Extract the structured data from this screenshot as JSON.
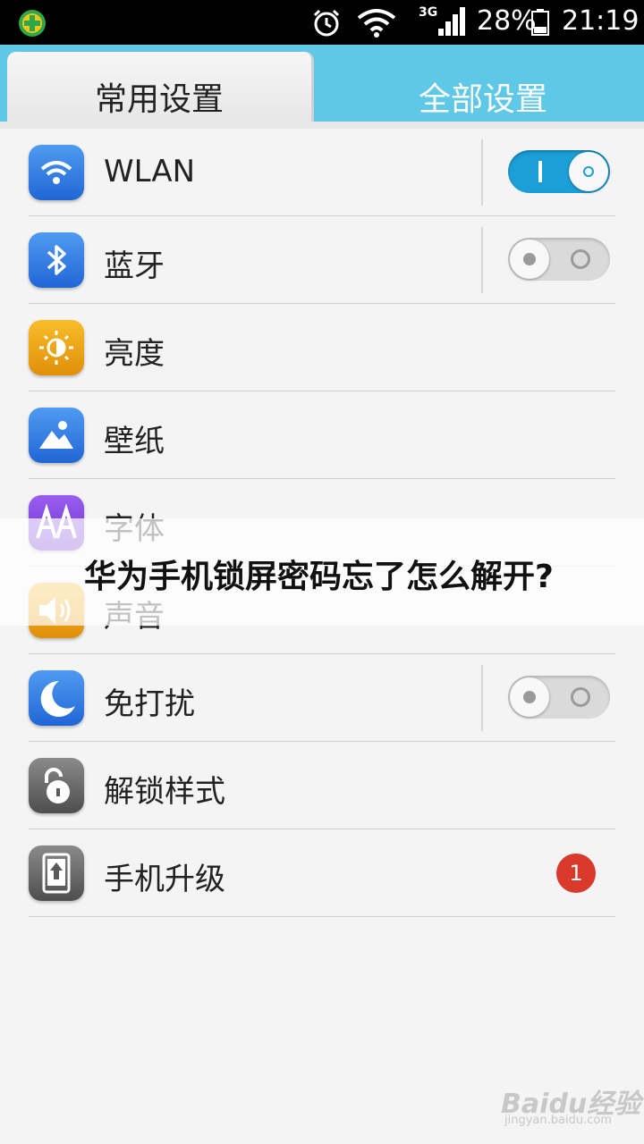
{
  "status_bar": {
    "network_type": "3G",
    "battery_percent": "28%",
    "time": "21:19",
    "icons": [
      "app-plus-icon",
      "alarm-icon",
      "wifi-icon",
      "signal-icon",
      "battery-icon"
    ]
  },
  "tabs": [
    {
      "label": "常用设置",
      "active": true
    },
    {
      "label": "全部设置",
      "active": false
    }
  ],
  "settings": [
    {
      "label": "WLAN",
      "icon": "wifi-icon",
      "icon_color": "#2f7de1",
      "toggle": "on"
    },
    {
      "label": "蓝牙",
      "icon": "bluetooth-icon",
      "icon_color": "#2f7de1",
      "toggle": "off"
    },
    {
      "label": "亮度",
      "icon": "brightness-icon",
      "icon_color": "#f0a010"
    },
    {
      "label": "壁纸",
      "icon": "wallpaper-icon",
      "icon_color": "#2f7de1"
    },
    {
      "label": "字体",
      "icon": "font-icon",
      "icon_color": "#7a3fd6"
    },
    {
      "label": "声音",
      "icon": "sound-icon",
      "icon_color": "#f0a010"
    },
    {
      "label": "免打扰",
      "icon": "moon-icon",
      "icon_color": "#2f7de1",
      "toggle": "off"
    },
    {
      "label": "解锁样式",
      "icon": "unlock-icon",
      "icon_color": "#606060"
    },
    {
      "label": "手机升级",
      "icon": "upgrade-icon",
      "icon_color": "#606060",
      "badge": "1"
    }
  ],
  "overlay_title": "华为手机锁屏密码忘了怎么解开?",
  "watermark": {
    "logo": "Baidu经验",
    "url": "jingyan.baidu.com"
  },
  "colors": {
    "tab_bar": "#5ec8e6",
    "toggle_on": "#1b9fd6",
    "badge": "#d93a2b"
  }
}
